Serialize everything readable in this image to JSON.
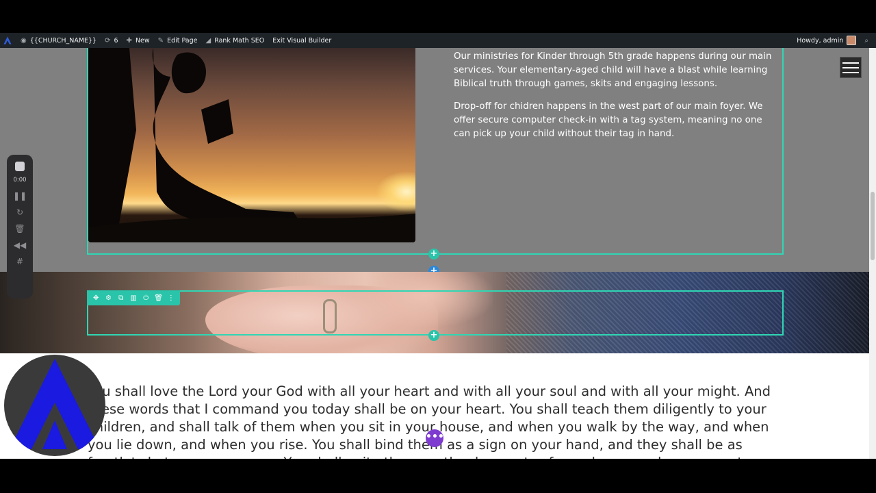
{
  "adminbar": {
    "site_name": "{{CHURCH_NAME}}",
    "updates_count": "6",
    "new_label": "New",
    "edit_page_label": "Edit Page",
    "rank_math_label": "Rank Math SEO",
    "exit_builder_label": "Exit Visual Builder",
    "howdy_label": "Howdy, admin"
  },
  "recorder": {
    "time": "0:00"
  },
  "section1": {
    "paragraph1": "Our ministries for Kinder through 5th grade happens during our main services.  Your elementary-aged child will have a blast while learning Biblical truth through games, skits and engaging lessons.",
    "paragraph2": "Drop-off for chidren happens in the west part of our main foyer. We offer secure computer check-in with a tag system, meaning no one can pick up your child without their tag in hand."
  },
  "verse": {
    "text": "You shall love the Lord your God with all your heart and with all your soul and with all your might. And these words that I command you today shall be on your heart. You shall teach them diligently to your children, and shall talk of them when you sit in your house, and when you walk by the way, and when you lie down, and when you rise.  You shall bind them as a sign on your hand, and they shall be as frontlets between your eyes. You shall write them on the doorposts of your house and on your gates."
  },
  "builder": {
    "add_symbol": "+",
    "more_symbol": "•••"
  },
  "colors": {
    "builder_teal": "#29c4a9",
    "builder_blue": "#2b87da",
    "builder_purple": "#7e3bd0",
    "logo_blue": "#1a1ae0"
  }
}
